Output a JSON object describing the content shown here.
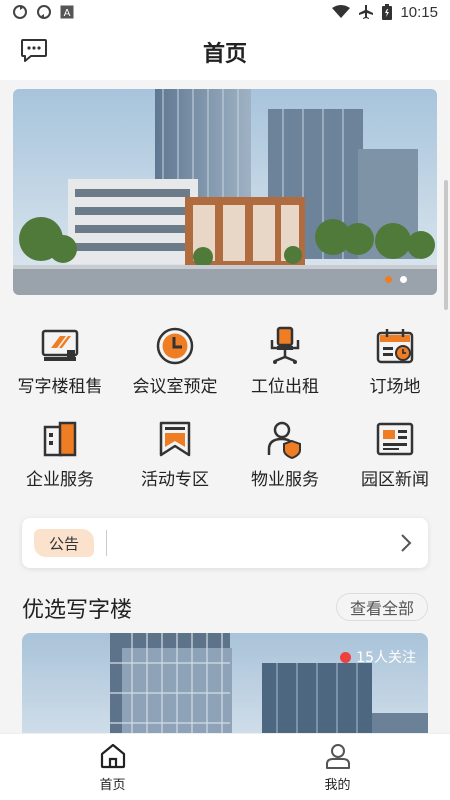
{
  "status_bar": {
    "time": "10:15",
    "left_icons": [
      "sync-icon",
      "sync-icon",
      "font-icon"
    ],
    "right_icons": [
      "wifi-icon",
      "airplane-icon",
      "battery-icon"
    ]
  },
  "header": {
    "title": "首页",
    "message_icon": "chat-bubble-icon"
  },
  "banner": {
    "dots": [
      true,
      false
    ]
  },
  "services": [
    {
      "label": "写字楼租售",
      "icon": "monitor-icon"
    },
    {
      "label": "会议室预定",
      "icon": "clock-icon"
    },
    {
      "label": "工位出租",
      "icon": "office-chair-icon"
    },
    {
      "label": "订场地",
      "icon": "calendar-icon"
    },
    {
      "label": "企业服务",
      "icon": "briefcase-icon"
    },
    {
      "label": "活动专区",
      "icon": "bookmark-icon"
    },
    {
      "label": "物业服务",
      "icon": "person-shield-icon"
    },
    {
      "label": "园区新闻",
      "icon": "newspaper-icon"
    }
  ],
  "notice": {
    "tag": "公告",
    "text": ""
  },
  "featured": {
    "title": "优选写字楼",
    "see_all": "查看全部",
    "card": {
      "followers": "15人关注"
    }
  },
  "bottom_nav": [
    {
      "label": "首页",
      "icon": "home-icon",
      "active": true
    },
    {
      "label": "我的",
      "icon": "user-icon",
      "active": false
    }
  ],
  "colors": {
    "accent": "#ef7d24",
    "tag_bg": "#fbe2cc"
  }
}
